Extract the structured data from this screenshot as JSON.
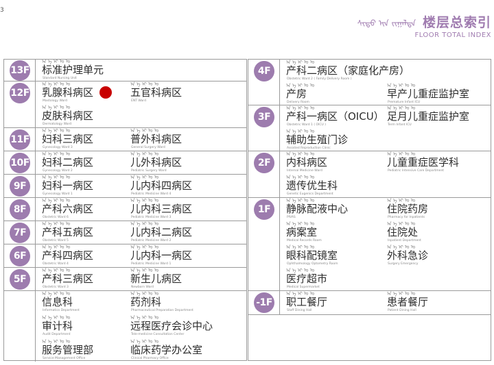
{
  "corner_mark": "3",
  "header": {
    "mongolian": "ᠰᠢᠲᠦ ᠢᠨ ᠵᠢᠭᠠᠯᠲᠠ",
    "title": "楼层总索引",
    "subtitle": "FLOOR TOTAL INDEX"
  },
  "colors": {
    "accent": "#9d7cae",
    "marker": "#c80000",
    "border": "#9a9a9a"
  },
  "mongolian_script": "ᠠ ᠡ ᠢ ᠣ ᠤ",
  "left_floors": [
    {
      "badge": "13F",
      "depts": [
        {
          "cn": "标准护理单元",
          "en": "Standard Nursing Unit"
        }
      ]
    },
    {
      "badge": "12F",
      "depts": [
        {
          "cn": "乳腺科病区",
          "en": "Mastology Ward",
          "marker": true
        },
        {
          "cn": "五官科病区",
          "en": "ENT Ward"
        },
        {
          "cn": "皮肤科病区",
          "en": "Dermatology Ward"
        }
      ]
    },
    {
      "badge": "11F",
      "depts": [
        {
          "cn": "妇科三病区",
          "en": "Gynecology Ward 3"
        },
        {
          "cn": "普外科病区",
          "en": "General Surgery Ward"
        }
      ]
    },
    {
      "badge": "10F",
      "depts": [
        {
          "cn": "妇科二病区",
          "en": "Gynecology Ward 2"
        },
        {
          "cn": "儿外科病区",
          "en": "Pediatric Surgery Ward"
        }
      ]
    },
    {
      "badge": "9F",
      "depts": [
        {
          "cn": "妇科一病区",
          "en": "Gynecology Ward 1"
        },
        {
          "cn": "儿内科四病区",
          "en": "Pediatric Medicine Ward 4"
        }
      ]
    },
    {
      "badge": "8F",
      "depts": [
        {
          "cn": "产科六病区",
          "en": "Obstetric Ward 6"
        },
        {
          "cn": "儿内科三病区",
          "en": "Pediatric Medicine Ward 3"
        }
      ]
    },
    {
      "badge": "7F",
      "depts": [
        {
          "cn": "产科五病区",
          "en": "Obstetric Ward 5"
        },
        {
          "cn": "儿内科二病区",
          "en": "Pediatric Medicine Ward 2"
        }
      ]
    },
    {
      "badge": "6F",
      "depts": [
        {
          "cn": "产科四病区",
          "en": "Obstetric Ward 4"
        },
        {
          "cn": "儿内科一病区",
          "en": "Pediatric Medicine Ward 1"
        }
      ]
    },
    {
      "badge": "5F",
      "depts": [
        {
          "cn": "产科三病区",
          "en": "Obstetric Ward 3"
        },
        {
          "cn": "新生儿病区",
          "en": "Newborn Ward"
        }
      ]
    },
    {
      "badge": "",
      "depts": [
        {
          "cn": "信息科",
          "en": "Informatics Department"
        },
        {
          "cn": "药剂科",
          "en": "Pharmaceutical Preparation Department"
        },
        {
          "cn": "审计科",
          "en": "Audit Department"
        },
        {
          "cn": "远程医疗会诊中心",
          "en": "Tele-medicine Consultation Center"
        },
        {
          "cn": "服务管理部",
          "en": "Service Management Office"
        },
        {
          "cn": "临床药学办公室",
          "en": "Clinical Pharmacy Office"
        }
      ]
    }
  ],
  "right_floors": [
    {
      "badge": "4F",
      "depts": [
        {
          "cn": "产科二病区（家庭化产房）",
          "en": "Obstetric Ward 2 ( Family Delivery Room )"
        },
        {
          "cn": "产房",
          "en": "Delivery Room"
        },
        {
          "cn": "早产儿重症监护室",
          "en": "Premature Infant ICU"
        }
      ]
    },
    {
      "badge": "3F",
      "depts": [
        {
          "cn": "产科一病区（OICU）",
          "en": "Obstetric Ward 1 ( OICU )"
        },
        {
          "cn": "足月儿重症监护室",
          "en": "Term Infant ICU"
        },
        {
          "cn": "辅助生殖门诊",
          "en": "Assisted Reproduction Clinic"
        }
      ]
    },
    {
      "badge": "2F",
      "depts": [
        {
          "cn": "内科病区",
          "en": "Internal Medicine Ward"
        },
        {
          "cn": "儿童重症医学科",
          "en": "Pediatric Intensive Care Department"
        },
        {
          "cn": "遗传优生科",
          "en": "Genetic Eugenics Department"
        }
      ]
    },
    {
      "badge": "1F",
      "depts": [
        {
          "cn": "静脉配液中心",
          "en": "PIVAS"
        },
        {
          "cn": "住院药房",
          "en": "Pharmacy for Inpatients"
        },
        {
          "cn": "病案室",
          "en": "Medical Records Room"
        },
        {
          "cn": "住院处",
          "en": "Inpatient Department"
        },
        {
          "cn": "眼科配镜室",
          "en": "Ophthalmology Optometry Room"
        },
        {
          "cn": "外科急诊",
          "en": "Surgery Emergency"
        },
        {
          "cn": "医疗超市",
          "en": "Medical Supermarket"
        }
      ]
    },
    {
      "badge": "-1F",
      "depts": [
        {
          "cn": "职工餐厅",
          "en": "Staff Dining Hall"
        },
        {
          "cn": "患者餐厅",
          "en": "Patient Dining Hall"
        }
      ]
    },
    {
      "badge": "",
      "depts": []
    }
  ]
}
